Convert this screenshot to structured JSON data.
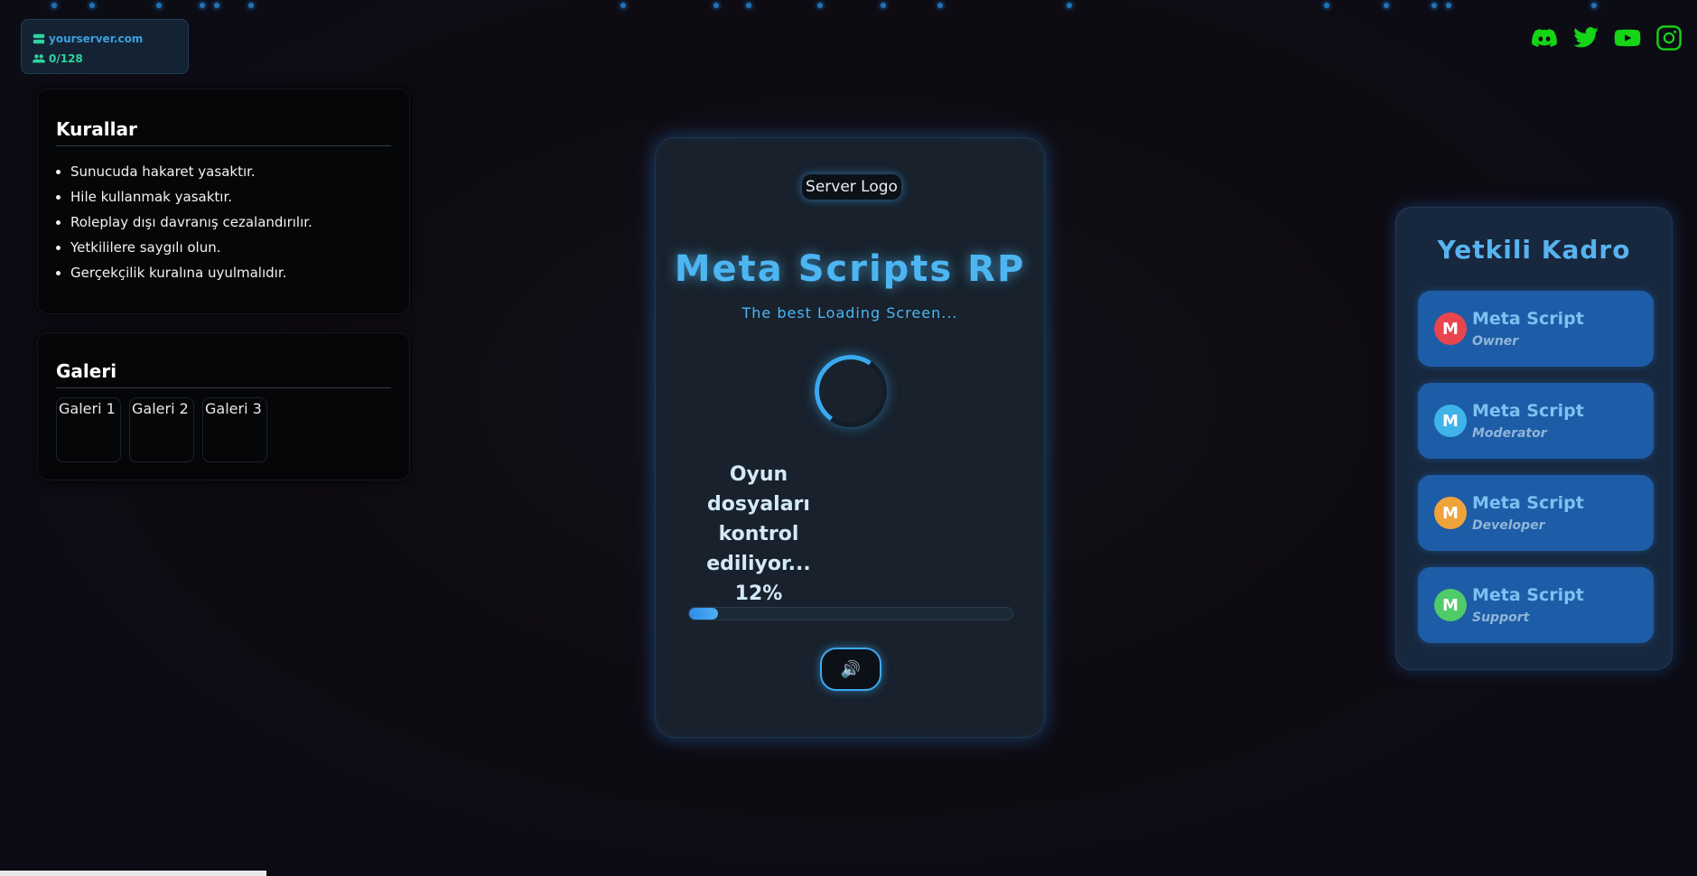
{
  "server": {
    "address": "yourserver.com",
    "players": "0/128"
  },
  "socials": [
    "discord-icon",
    "twitter-icon",
    "youtube-icon",
    "instagram-icon"
  ],
  "rules": {
    "title": "Kurallar",
    "items": [
      "Sunucuda hakaret yasaktır.",
      "Hile kullanmak yasaktır.",
      "Roleplay dışı davranış cezalandırılır.",
      "Yetkililere saygılı olun.",
      "Gerçekçilik kuralına uyulmalıdır."
    ]
  },
  "gallery": {
    "title": "Galeri",
    "images": [
      "Galeri 1",
      "Galeri 2",
      "Galeri 3"
    ]
  },
  "loading": {
    "logo_alt": "Server Logo",
    "title": "Meta Scripts RP",
    "subtitle": "The best Loading Screen...",
    "status": "Oyun dosyaları kontrol ediliyor... 12%",
    "progress_percent": 12,
    "sound_icon": "speaker-icon"
  },
  "staff": {
    "title": "Yetkili Kadro",
    "members": [
      {
        "initial": "M",
        "name": "Meta Script",
        "role": "Owner",
        "color": "#e8454f"
      },
      {
        "initial": "M",
        "name": "Meta Script",
        "role": "Moderator",
        "color": "#3fb3ea"
      },
      {
        "initial": "M",
        "name": "Meta Script",
        "role": "Developer",
        "color": "#f0a33a"
      },
      {
        "initial": "M",
        "name": "Meta Script",
        "role": "Support",
        "color": "#4fcb6a"
      }
    ]
  },
  "colors": {
    "accent": "#4db6f2",
    "social": "#16d416",
    "players": "#2fd3a0"
  }
}
